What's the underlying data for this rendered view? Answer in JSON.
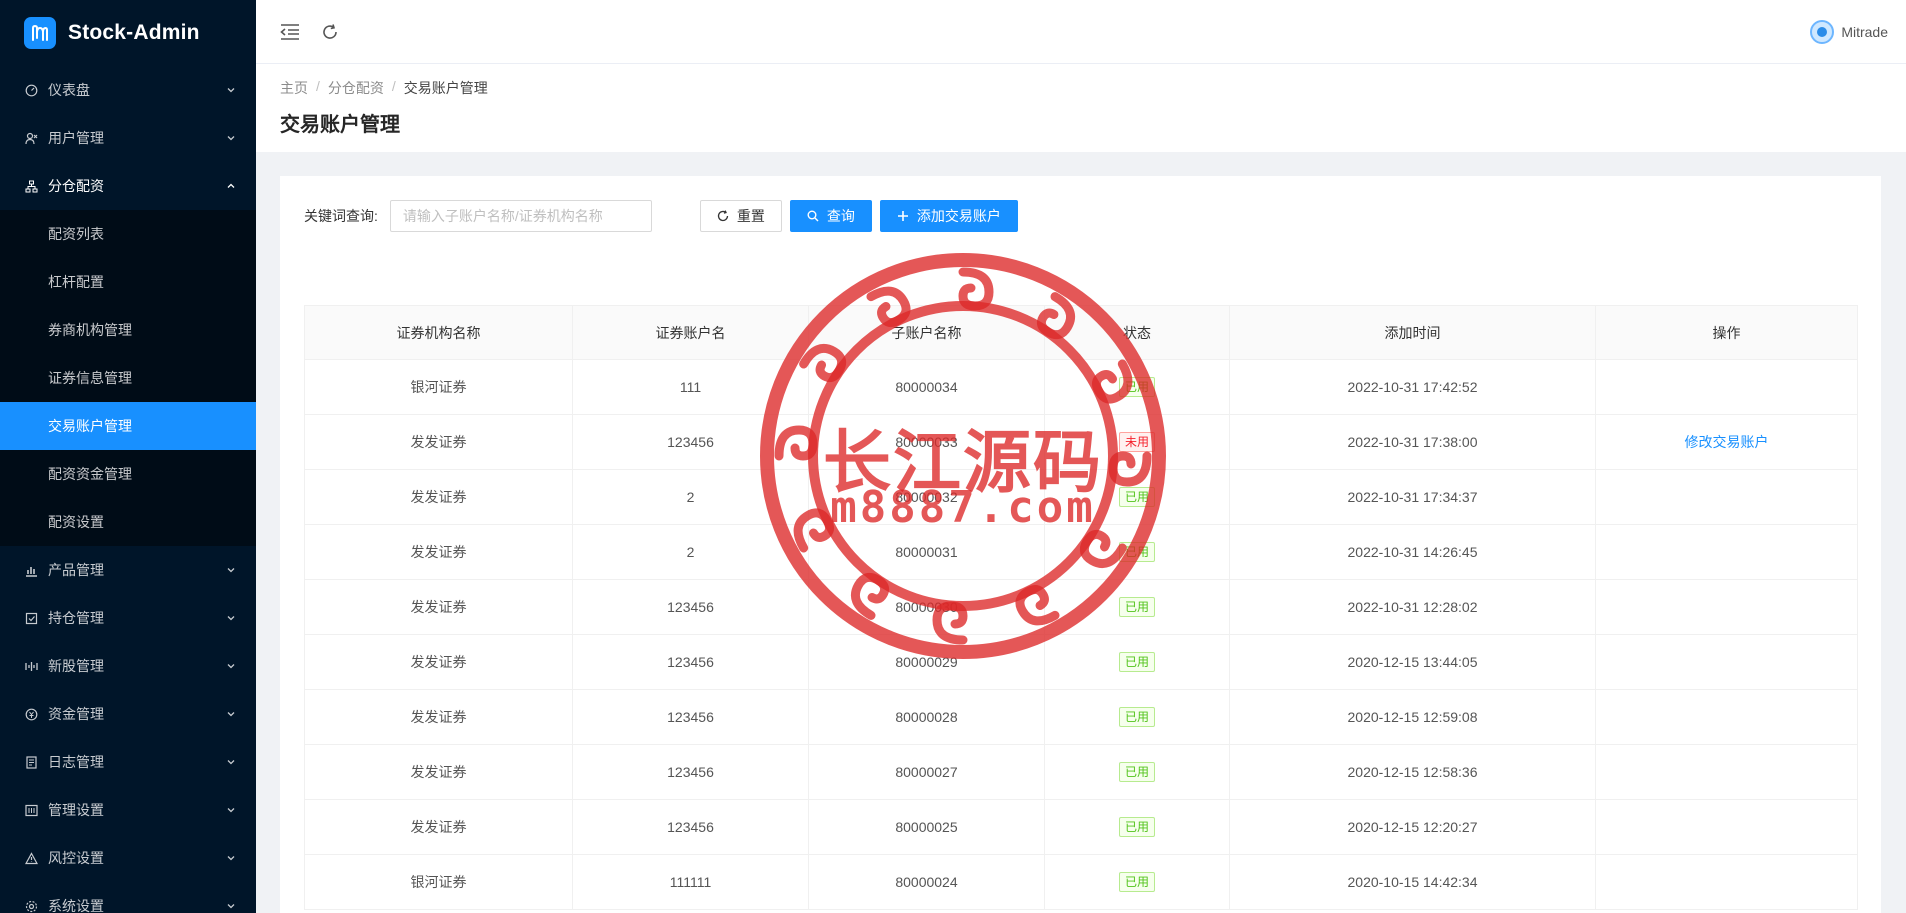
{
  "app": {
    "name": "Stock-Admin"
  },
  "header": {
    "user_name": "Mitrade"
  },
  "sidebar": {
    "menu": [
      {
        "label": "仪表盘",
        "icon": "dashboard-icon",
        "open": false
      },
      {
        "label": "用户管理",
        "icon": "user-icon",
        "open": false
      },
      {
        "label": "分仓配资",
        "icon": "sitemap-icon",
        "open": true,
        "children": [
          {
            "label": "配资列表",
            "active": false
          },
          {
            "label": "杠杆配置",
            "active": false
          },
          {
            "label": "券商机构管理",
            "active": false
          },
          {
            "label": "证券信息管理",
            "active": false
          },
          {
            "label": "交易账户管理",
            "active": true
          },
          {
            "label": "配资资金管理",
            "active": false
          },
          {
            "label": "配资设置",
            "active": false
          }
        ]
      },
      {
        "label": "产品管理",
        "icon": "chart-icon",
        "open": false
      },
      {
        "label": "持仓管理",
        "icon": "position-icon",
        "open": false
      },
      {
        "label": "新股管理",
        "icon": "ipo-icon",
        "open": false
      },
      {
        "label": "资金管理",
        "icon": "money-icon",
        "open": false
      },
      {
        "label": "日志管理",
        "icon": "log-icon",
        "open": false
      },
      {
        "label": "管理设置",
        "icon": "settings-icon",
        "open": false
      },
      {
        "label": "风控设置",
        "icon": "warning-icon",
        "open": false
      },
      {
        "label": "系统设置",
        "icon": "gear-icon",
        "open": false
      }
    ]
  },
  "breadcrumb": [
    "主页",
    "分仓配资",
    "交易账户管理"
  ],
  "page_title": "交易账户管理",
  "search": {
    "label": "关键词查询:",
    "placeholder": "请输入子账户名称/证券机构名称",
    "value": "",
    "reset_label": "重置",
    "query_label": "查询",
    "add_label": "添加交易账户"
  },
  "table": {
    "columns": [
      "证券机构名称",
      "证券账户名",
      "子账户名称",
      "状态",
      "添加时间",
      "操作"
    ],
    "rows": [
      {
        "broker": "银河证券",
        "account": "111",
        "sub_account": "80000034",
        "status": "已用",
        "status_type": "used",
        "time": "2022-10-31 17:42:52",
        "action": ""
      },
      {
        "broker": "发发证券",
        "account": "123456",
        "sub_account": "80000033",
        "status": "未用",
        "status_type": "unused",
        "time": "2022-10-31 17:38:00",
        "action": "修改交易账户"
      },
      {
        "broker": "发发证券",
        "account": "2",
        "sub_account": "80000032",
        "status": "已用",
        "status_type": "used",
        "time": "2022-10-31 17:34:37",
        "action": ""
      },
      {
        "broker": "发发证券",
        "account": "2",
        "sub_account": "80000031",
        "status": "已用",
        "status_type": "used",
        "time": "2022-10-31 14:26:45",
        "action": ""
      },
      {
        "broker": "发发证券",
        "account": "123456",
        "sub_account": "80000030",
        "status": "已用",
        "status_type": "used",
        "time": "2022-10-31 12:28:02",
        "action": ""
      },
      {
        "broker": "发发证券",
        "account": "123456",
        "sub_account": "80000029",
        "status": "已用",
        "status_type": "used",
        "time": "2020-12-15 13:44:05",
        "action": ""
      },
      {
        "broker": "发发证券",
        "account": "123456",
        "sub_account": "80000028",
        "status": "已用",
        "status_type": "used",
        "time": "2020-12-15 12:59:08",
        "action": ""
      },
      {
        "broker": "发发证券",
        "account": "123456",
        "sub_account": "80000027",
        "status": "已用",
        "status_type": "used",
        "time": "2020-12-15 12:58:36",
        "action": ""
      },
      {
        "broker": "发发证券",
        "account": "123456",
        "sub_account": "80000025",
        "status": "已用",
        "status_type": "used",
        "time": "2020-12-15 12:20:27",
        "action": ""
      },
      {
        "broker": "银河证券",
        "account": "111111",
        "sub_account": "80000024",
        "status": "已用",
        "status_type": "used",
        "time": "2020-10-15 14:42:34",
        "action": ""
      }
    ]
  },
  "watermark": {
    "line1": "长江源码",
    "line2": "m8887.com"
  },
  "colors": {
    "sidebar_bg": "#001529",
    "primary": "#1890ff",
    "success": "#52c41a",
    "danger": "#f5222d",
    "watermark": "#dc2828"
  }
}
